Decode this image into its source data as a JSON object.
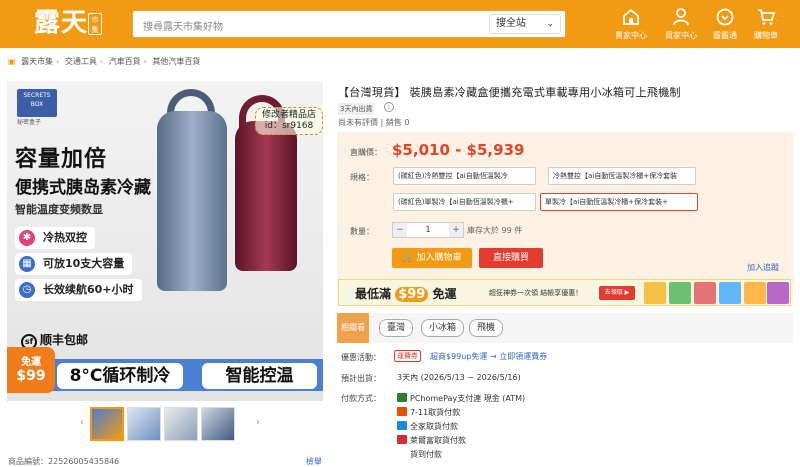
{
  "header": {
    "logo": "露天",
    "logo_badge": "市集",
    "search_placeholder": "搜尋露天市集好物",
    "search_scope": "搜全站",
    "nav": [
      {
        "icon": "store-icon",
        "label": "賣家中心"
      },
      {
        "icon": "user-icon",
        "label": "買家中心"
      },
      {
        "icon": "coin-icon",
        "label": "露露通"
      },
      {
        "icon": "cart-icon",
        "label": "購物車"
      }
    ]
  },
  "breadcrumb": [
    "露天市集",
    "交通工具",
    "汽車百貨",
    "其他汽車百貨"
  ],
  "hero": {
    "brand": "SECRETS BOX",
    "brand_sub": "秘密盒子",
    "headline1": "容量加倍",
    "headline2": "便携式胰岛素冷藏",
    "headline3": "智能温度变频数显",
    "features": [
      "冷热双控",
      "可放10支大容量",
      "长效续航60+小时"
    ],
    "shipping": "顺丰包邮",
    "bottom_left": "8°C循环制冷",
    "bottom_right": "智能控温",
    "free_ship_1": "免運",
    "free_ship_2": "$99",
    "watermark_1": "修改者精品店",
    "watermark_2": "id：sr9168"
  },
  "footer": {
    "item_id_label": "商品編號：",
    "item_id": "22526005435846",
    "report": "檢舉"
  },
  "product": {
    "title": "【台灣現貨】 裝胰島素冷藏盒便攜充電式車載專用小冰箱可上飛機制",
    "delivery_tag": "3天內出貨",
    "rating": "尚未有評價",
    "sold_label": "銷售",
    "sold": "0",
    "price_label": "直購價：",
    "price": "$5,010 - $5,939",
    "spec_label": "規格：",
    "options": [
      "(碳紅色)冷熱雙控【ai自動恆溫製冷",
      "冷熱雙控【ai自動恆溫製冷櫃+保冷套裝",
      "(碳紅色)單製冷【ai自動恆溫製冷櫃+",
      "單製冷【ai自動恆溫製冷櫃+保冷套裝+"
    ],
    "qty_label": "數量：",
    "qty": "1",
    "stock": "庫存大於 99 件",
    "add_to_cart": "加入購物車",
    "buy_now": "直接購買",
    "follow": "加入追蹤"
  },
  "banner": {
    "text_pre": "最低滿",
    "amount": "$99",
    "text_post": "免運",
    "sub": "超狂神券一次領 結帳享優惠！",
    "cta": "去領取 ▶"
  },
  "tags": {
    "label": "相關看",
    "items": [
      "臺灣",
      "小冰箱",
      "飛機"
    ]
  },
  "promo": {
    "label": "優惠活動：",
    "tag": "運費券",
    "link": "超商$99up免運 → 立即領運費券"
  },
  "ship": {
    "label": "預計出貨：",
    "value": "3天內 (2026/5/13 ~ 2026/5/16)"
  },
  "payment": {
    "label": "付款方式：",
    "methods": [
      "PChomePay支付連 現金 (ATM)",
      "7-11取貨付款",
      "全家取貨付款",
      "萊爾富取貨付款",
      "貨到付款"
    ]
  }
}
